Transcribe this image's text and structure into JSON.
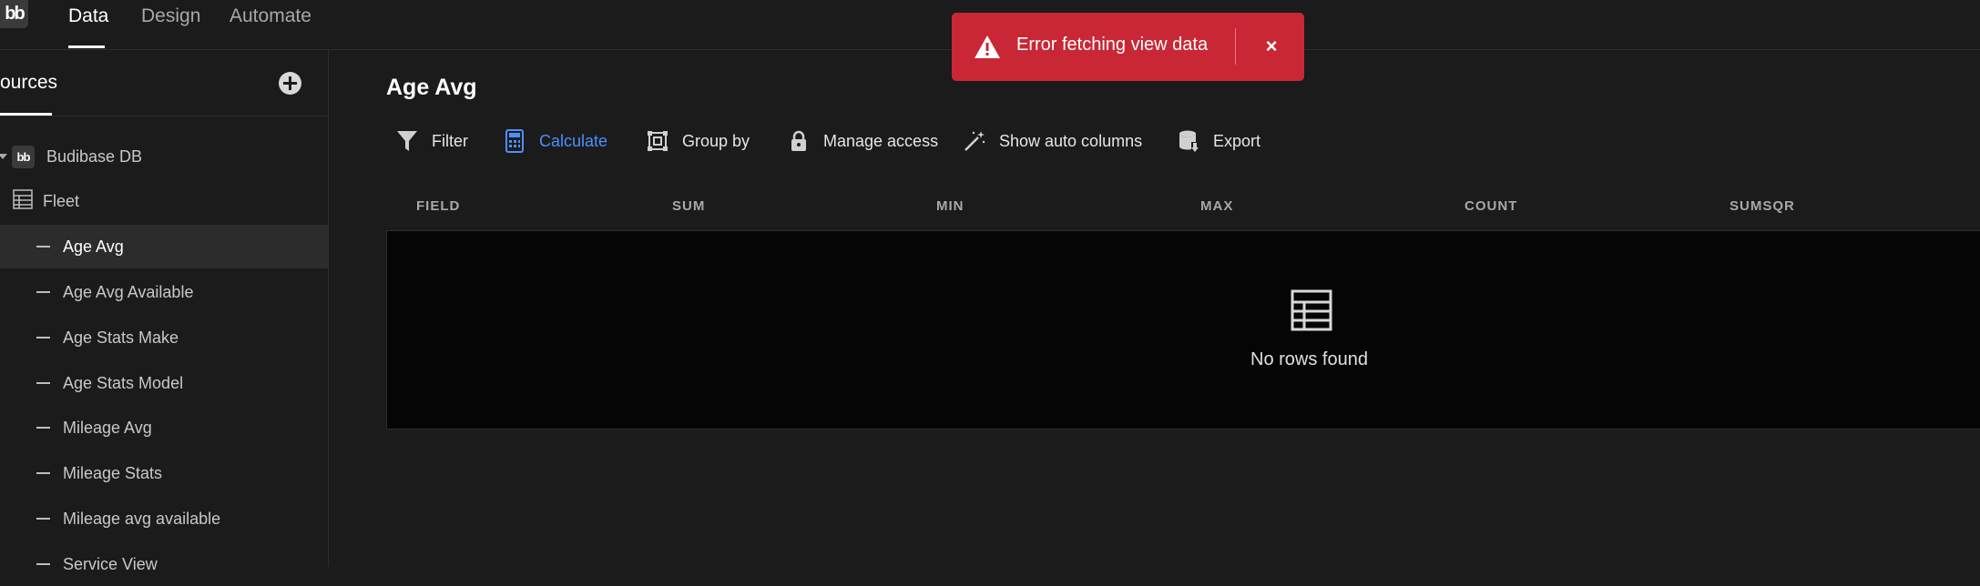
{
  "topbar": {
    "logo_text": "bb",
    "tabs": [
      {
        "label": "Data",
        "active": true
      },
      {
        "label": "Design",
        "active": false
      },
      {
        "label": "Automate",
        "active": false
      }
    ]
  },
  "sidebar": {
    "title": "ources",
    "datasource": "Budibase DB",
    "table": "Fleet",
    "views": [
      {
        "label": "Age Avg",
        "selected": true
      },
      {
        "label": "Age Avg Available"
      },
      {
        "label": "Age Stats Make"
      },
      {
        "label": "Age Stats Model"
      },
      {
        "label": "Mileage Avg"
      },
      {
        "label": "Mileage Stats"
      },
      {
        "label": "Mileage avg available"
      },
      {
        "label": "Service View"
      }
    ]
  },
  "main": {
    "title": "Age Avg",
    "toolbar": {
      "filter": "Filter",
      "calculate": "Calculate",
      "group_by": "Group by",
      "manage_access": "Manage access",
      "show_auto_columns": "Show auto columns",
      "export": "Export"
    },
    "columns": [
      "FIELD",
      "SUM",
      "MIN",
      "MAX",
      "COUNT",
      "SUMSQR"
    ],
    "empty_text": "No rows found"
  },
  "toast": {
    "message": "Error fetching view data",
    "close_label": "×"
  },
  "colors": {
    "accent": "#4d8fff",
    "error": "#c92735",
    "background": "#1b1b1b"
  }
}
